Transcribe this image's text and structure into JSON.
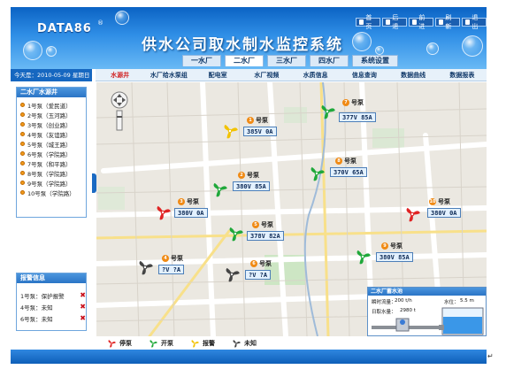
{
  "header": {
    "logo": "DATA86",
    "logo_mark": "®",
    "title": "供水公司取水制水监控系统",
    "tools": [
      {
        "label": "首页",
        "icon": "home-icon"
      },
      {
        "label": "后退",
        "icon": "back-icon"
      },
      {
        "label": "前进",
        "icon": "forward-icon"
      },
      {
        "label": "刷新",
        "icon": "refresh-icon"
      },
      {
        "label": "退出",
        "icon": "exit-icon"
      }
    ]
  },
  "main_tabs": [
    "一水厂",
    "二水厂",
    "三水厂",
    "四水厂",
    "系统设置"
  ],
  "active_tab": 1,
  "sub_nav": [
    "水源井",
    "水厂给水泵组",
    "配电室",
    "水厂视频",
    "水质信息",
    "信息查询",
    "数据曲线",
    "数据报表"
  ],
  "active_sub_nav": 0,
  "left_panel": {
    "date": "今天是：2010-05-09 星期日",
    "pumps_title": "二水厂水源井",
    "pumps": [
      "1号泵（爱民道）",
      "2号泵（玉河路）",
      "3号泵（创业路）",
      "4号泵（友谊路）",
      "5号泵（城王路）",
      "6号泵（学院路）",
      "7号泵（和平路）",
      "8号泵（学院路）",
      "9号泵（学院路）",
      "10号泵（学院路）"
    ],
    "alarm_title": "报警信息",
    "alarms": [
      {
        "pump": "1号泵：",
        "status": "保护报警"
      },
      {
        "pump": "4号泵：",
        "status": "未知"
      },
      {
        "pump": "6号泵：",
        "status": "未知"
      }
    ]
  },
  "map": {
    "pumps": [
      {
        "num": "1",
        "label": "号泵",
        "reading": "385V 0A",
        "status": "alarm"
      },
      {
        "num": "2",
        "label": "号泵",
        "reading": "380V 85A",
        "status": "running"
      },
      {
        "num": "3",
        "label": "号泵",
        "reading": "380V 0A",
        "status": "stopped"
      },
      {
        "num": "4",
        "label": "号泵",
        "reading": "?V ?A",
        "status": "unknown"
      },
      {
        "num": "5",
        "label": "号泵",
        "reading": "378V 82A",
        "status": "running"
      },
      {
        "num": "6",
        "label": "号泵",
        "reading": "?V ?A",
        "status": "unknown"
      },
      {
        "num": "7",
        "label": "号泵",
        "reading": "377V 85A",
        "status": "running"
      },
      {
        "num": "8",
        "label": "号泵",
        "reading": "370V 65A",
        "status": "running"
      },
      {
        "num": "9",
        "label": "号泵",
        "reading": "380V 85A",
        "status": "running"
      },
      {
        "num": "10",
        "label": "号泵",
        "reading": "380V 0A",
        "status": "stopped"
      }
    ]
  },
  "tank": {
    "title": "二水厂蓄水池",
    "flow_label": "瞬时流量：",
    "flow_value": "200 t/h",
    "level_label": "水位：",
    "level_value": "5.5 m",
    "daily_label": "日取水量：",
    "daily_value": "2980 t"
  },
  "legend": [
    {
      "label": "停泵",
      "status": "stopped"
    },
    {
      "label": "开泵",
      "status": "running"
    },
    {
      "label": "报警",
      "status": "alarm"
    },
    {
      "label": "未知",
      "status": "unknown"
    }
  ],
  "status_colors": {
    "stopped": "#e02424",
    "running": "#1fa83a",
    "alarm": "#f2c200",
    "unknown": "#444444"
  },
  "tail_mark": "↵"
}
